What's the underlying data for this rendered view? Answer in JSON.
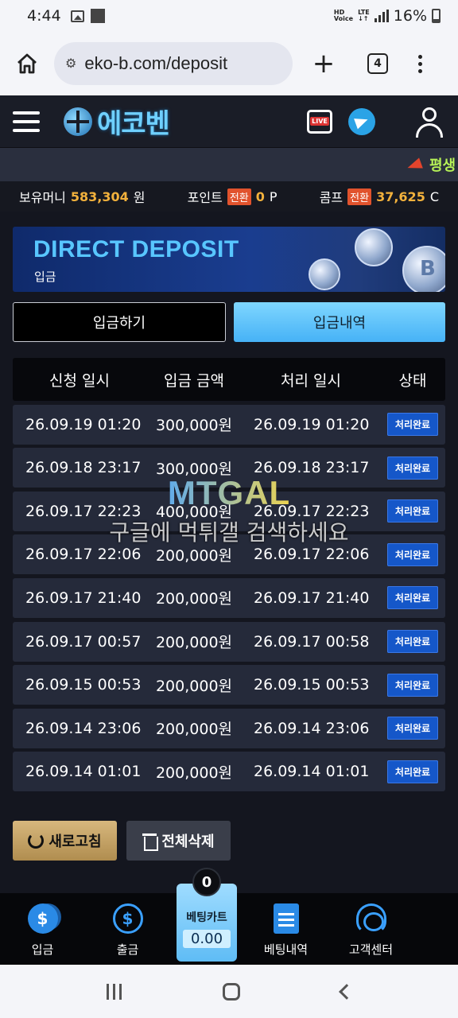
{
  "status_bar": {
    "time": "4:44",
    "network_top": "HD",
    "network_bottom": "Voice",
    "lte_top": "LTE",
    "lte_bottom": "↓↑",
    "battery": "16%"
  },
  "browser": {
    "url": "eko-b.com/deposit",
    "tab_count": "4"
  },
  "header": {
    "logo_text": "에코벤"
  },
  "marquee": {
    "text": "평생"
  },
  "balance": {
    "money_label": "보유머니",
    "money_value": "583,304",
    "money_unit": "원",
    "point_label": "포인트",
    "point_badge": "전환",
    "point_value": "0",
    "point_unit": "P",
    "comp_label": "콤프",
    "comp_badge": "전환",
    "comp_value": "37,625",
    "comp_unit": "C"
  },
  "banner": {
    "title": "DIRECT DEPOSIT",
    "subtitle": "입금"
  },
  "tabs": {
    "deposit": "입금하기",
    "history": "입금내역"
  },
  "table": {
    "headers": [
      "신청 일시",
      "입금 금액",
      "처리 일시",
      "상태"
    ],
    "rows": [
      {
        "req": "26.09.19 01:20",
        "amount": "300,000원",
        "done": "26.09.19 01:20",
        "status": "처리완료"
      },
      {
        "req": "26.09.18 23:17",
        "amount": "300,000원",
        "done": "26.09.18 23:17",
        "status": "처리완료"
      },
      {
        "req": "26.09.17 22:23",
        "amount": "400,000원",
        "done": "26.09.17 22:23",
        "status": "처리완료"
      },
      {
        "req": "26.09.17 22:06",
        "amount": "200,000원",
        "done": "26.09.17 22:06",
        "status": "처리완료"
      },
      {
        "req": "26.09.17 21:40",
        "amount": "200,000원",
        "done": "26.09.17 21:40",
        "status": "처리완료"
      },
      {
        "req": "26.09.17 00:57",
        "amount": "200,000원",
        "done": "26.09.17 00:58",
        "status": "처리완료"
      },
      {
        "req": "26.09.15 00:53",
        "amount": "200,000원",
        "done": "26.09.15 00:53",
        "status": "처리완료"
      },
      {
        "req": "26.09.14 23:06",
        "amount": "200,000원",
        "done": "26.09.14 23:06",
        "status": "처리완료"
      },
      {
        "req": "26.09.14 01:01",
        "amount": "200,000원",
        "done": "26.09.14 01:01",
        "status": "처리완료"
      }
    ]
  },
  "watermark": {
    "logo": "MTGAL",
    "text": "구글에 먹튀갤 검색하세요"
  },
  "actions": {
    "refresh": "새로고침",
    "delete_all": "전체삭제"
  },
  "bottom_nav": {
    "deposit": "입금",
    "withdraw": "출금",
    "cart_label": "베팅카트",
    "cart_count": "0",
    "cart_amount": "0.00",
    "history": "베팅내역",
    "support": "고객센터"
  },
  "colors": {
    "accent_blue": "#46b2f6",
    "gold": "#f2b13c",
    "status_blue": "#1557c9",
    "marquee_green": "#b6f257"
  },
  "icons": [
    "image-icon",
    "stop-icon",
    "signal-icon",
    "battery-icon",
    "home-icon",
    "tune-icon",
    "plus-icon",
    "more-icon",
    "hamburger-icon",
    "live-tv-icon",
    "telegram-icon",
    "user-icon",
    "megaphone-icon",
    "refresh-icon",
    "trash-icon",
    "coin-icon",
    "withdraw-icon",
    "document-icon",
    "headset-icon"
  ]
}
